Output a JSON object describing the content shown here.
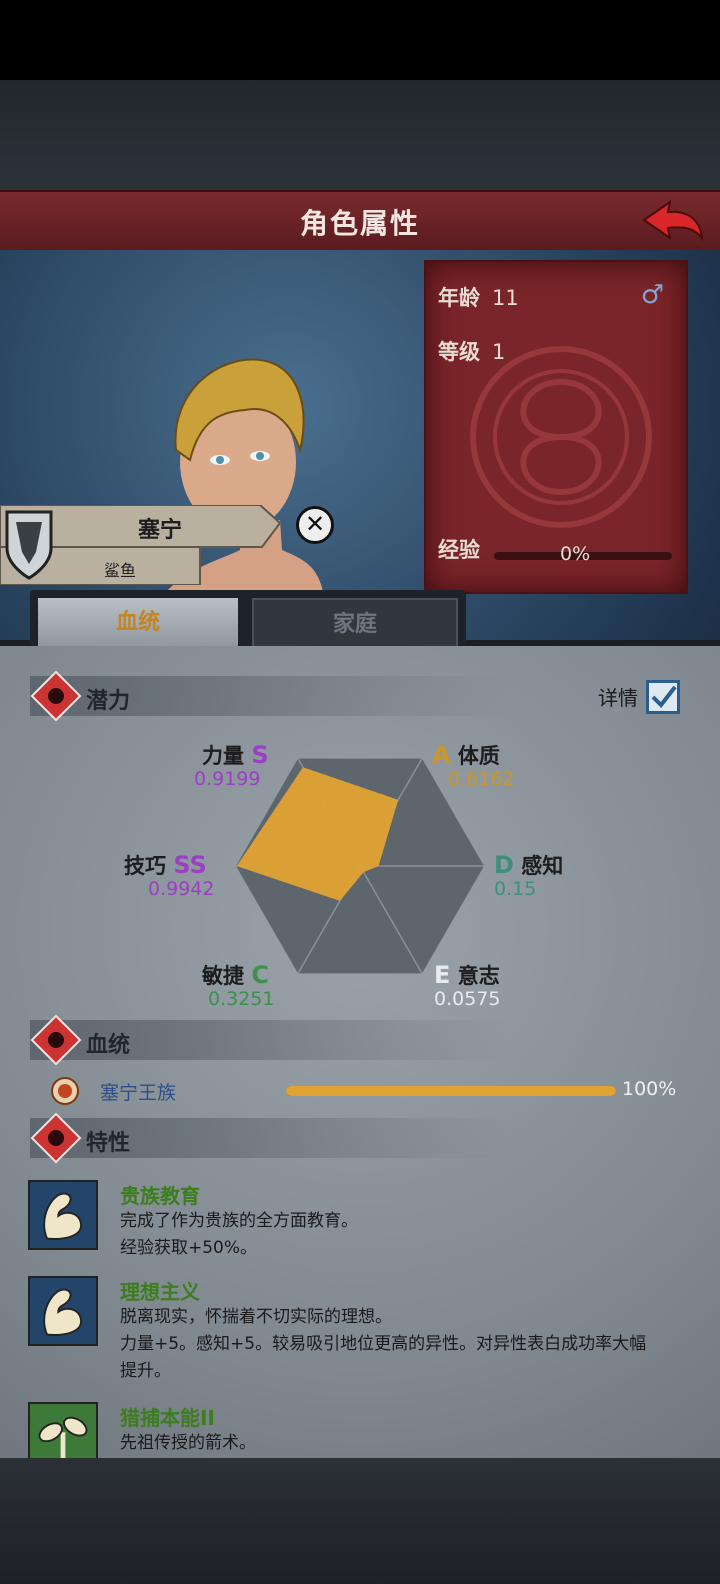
{
  "header": {
    "title": "角色属性"
  },
  "character": {
    "name": "塞宁",
    "house": "鲨鱼",
    "age_label": "年龄",
    "age": "11",
    "level_label": "等级",
    "level": "1",
    "xp_label": "经验",
    "xp_percent": "0%",
    "gender_icon": "male-icon"
  },
  "tabs": [
    {
      "label": "血统",
      "active": true
    },
    {
      "label": "家庭",
      "active": false
    }
  ],
  "potential": {
    "title": "潜力",
    "detail_label": "详情",
    "detail_checked": true,
    "stats": [
      {
        "name": "力量",
        "grade": "S",
        "value": "0.9199",
        "color": "#9b3fc4"
      },
      {
        "name": "体质",
        "grade": "A",
        "value": "0.6162",
        "color": "#c8962a"
      },
      {
        "name": "感知",
        "grade": "D",
        "value": "0.15",
        "color": "#3f8f7a"
      },
      {
        "name": "意志",
        "grade": "E",
        "value": "0.0575",
        "color": "#d8dde0"
      },
      {
        "name": "敏捷",
        "grade": "C",
        "value": "0.3251",
        "color": "#3f8f4f"
      },
      {
        "name": "技巧",
        "grade": "SS",
        "value": "0.9942",
        "color": "#9b3fc4"
      }
    ]
  },
  "chart_data": {
    "type": "radar",
    "axes": [
      "力量",
      "体质",
      "感知",
      "意志",
      "敏捷",
      "技巧"
    ],
    "values": [
      0.9199,
      0.6162,
      0.15,
      0.0575,
      0.3251,
      0.9942
    ],
    "range": [
      0,
      1
    ],
    "fill_color": "#e0a233"
  },
  "bloodline": {
    "title": "血统",
    "items": [
      {
        "name": "塞宁王族",
        "percent": "100%",
        "fraction": 1.0
      }
    ]
  },
  "traits": {
    "title": "特性",
    "items": [
      {
        "name": "贵族教育",
        "desc1": "完成了作为贵族的全方面教育。",
        "desc2": "经验获取+50%。",
        "desc3": ""
      },
      {
        "name": "理想主义",
        "desc1": "脱离现实，怀揣着不切实际的理想。",
        "desc2": "力量+5。感知+5。较易吸引地位更高的异性。对异性表白成功率大幅",
        "desc3": "提升。"
      },
      {
        "name": "猎捕本能II",
        "desc1": "先祖传授的箭术。",
        "desc2": "",
        "desc3": ""
      }
    ]
  }
}
